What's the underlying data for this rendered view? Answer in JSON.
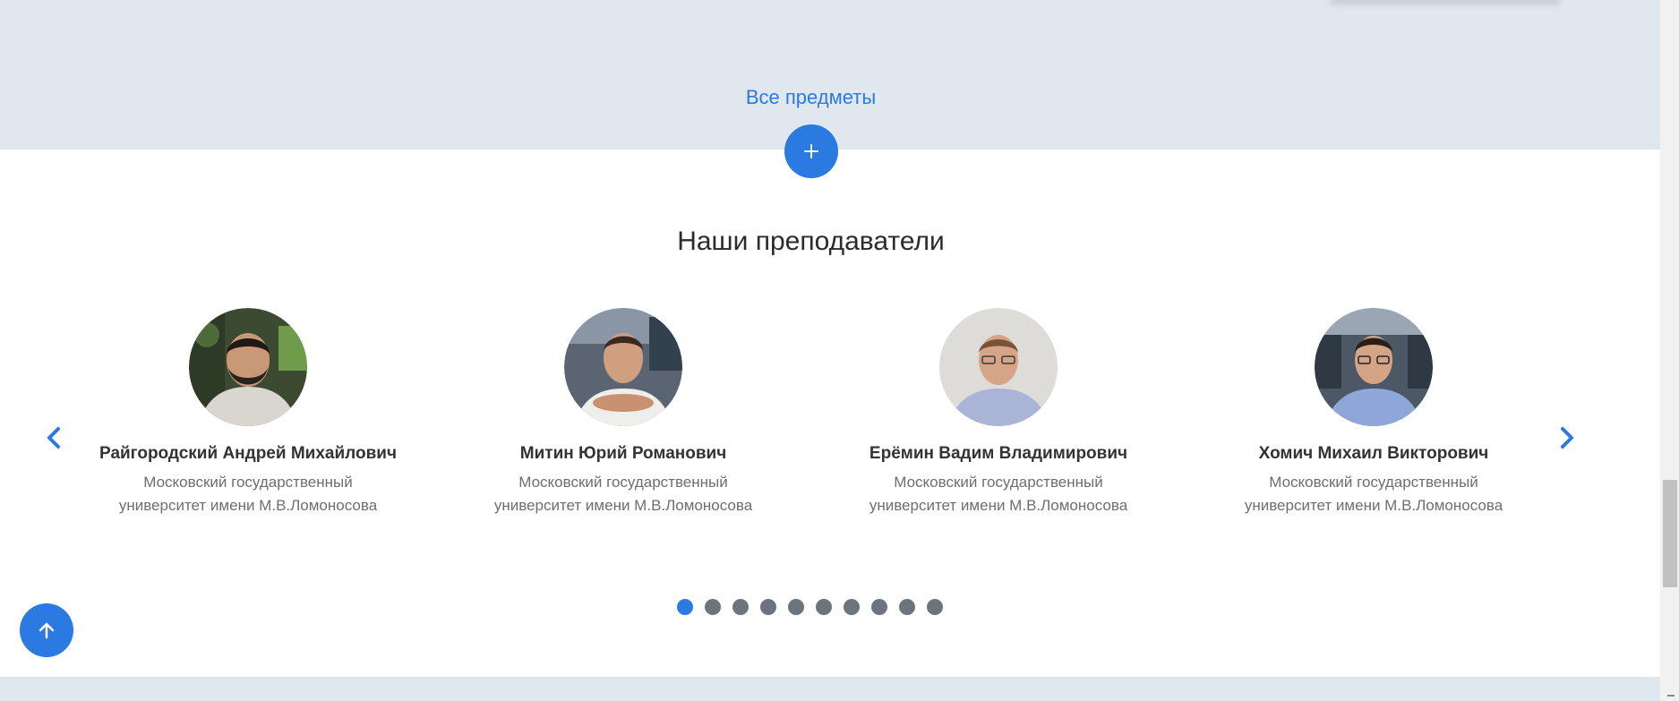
{
  "subjects": {
    "all_subjects_label": "Все предметы",
    "expand_icon": "plus-icon"
  },
  "teachers_section": {
    "title": "Наши преподаватели",
    "prev_icon": "chevron-left-icon",
    "next_icon": "chevron-right-icon",
    "teachers": [
      {
        "name": "Райгородский Андрей Михайлович",
        "org": "Московский государственный университет имени М.В.Ломоносова"
      },
      {
        "name": "Митин Юрий Романович",
        "org": "Московский государственный университет имени М.В.Ломоносова"
      },
      {
        "name": "Ерёмин Вадим Владимирович",
        "org": "Московский государственный университет имени М.В.Ломоносова"
      },
      {
        "name": "Хомич Михаил Викторович",
        "org": "Московский государственный университет имени М.В.Ломоносова"
      }
    ],
    "pagination": {
      "total": 10,
      "active": 1
    }
  },
  "scroll_top_icon": "arrow-up-icon",
  "colors": {
    "accent": "#2a7ae2",
    "band": "#e1e7ee",
    "dot_inactive": "#6c757d"
  }
}
